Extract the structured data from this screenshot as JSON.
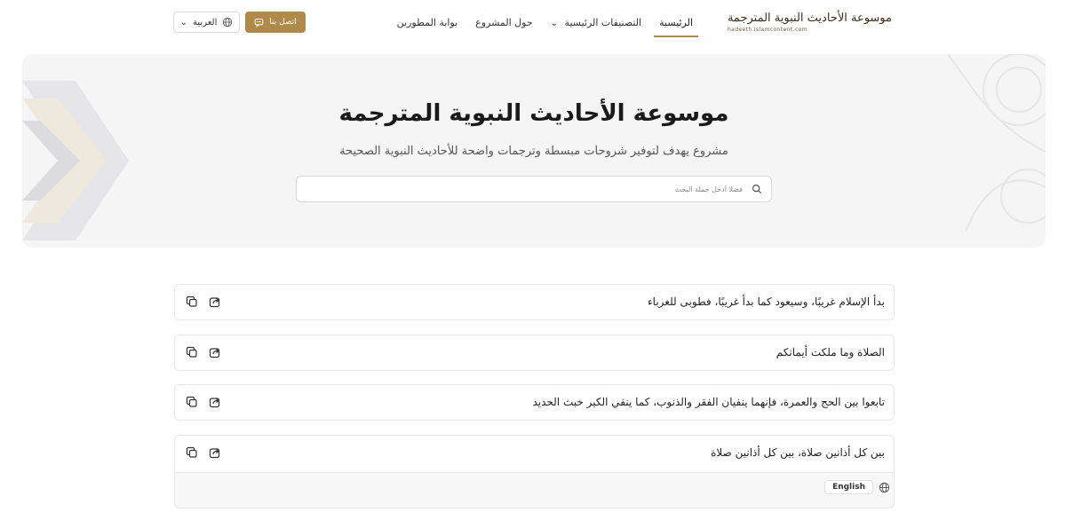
{
  "header": {
    "logo_title": "موسوعة الأحاديث النبوية المترجمة",
    "logo_url": "hadeeth.islamcontent.com",
    "nav": [
      {
        "label": "الرئيسية",
        "active": true
      },
      {
        "label": "التصنيفات الرئيسية",
        "dropdown": true
      },
      {
        "label": "حول المشروع"
      },
      {
        "label": "بوابة المطورين"
      }
    ],
    "contact_label": "اتصل بنا",
    "language_label": "العربية"
  },
  "hero": {
    "title": "موسوعة الأحاديث النبوية المترجمة",
    "subtitle": "مشروع يهدف لتوفير شروحات مبسطة وترجمات واضحة للأحاديث النبوية الصحيحة",
    "search_placeholder": "فضلا أدخل جملة البحث"
  },
  "hadiths": [
    {
      "text": "بدأ الإسلام غريبًا، وسيعود كما بدأ غريبًا، فطوبى للغرباء"
    },
    {
      "text": "الصلاة وما ملكت أيمانكم"
    },
    {
      "text": "تابعوا بين الحج والعمرة، فإنهما ينفيان الفقر والذنوب، كما ينفي الكير خبث الحديد"
    },
    {
      "text": "بين كل أذانين صلاة، بين كل أذانين صلاة"
    }
  ],
  "translation_label": "English",
  "colors": {
    "accent": "#b08a4a",
    "hero_bg": "#f5f5f6"
  }
}
